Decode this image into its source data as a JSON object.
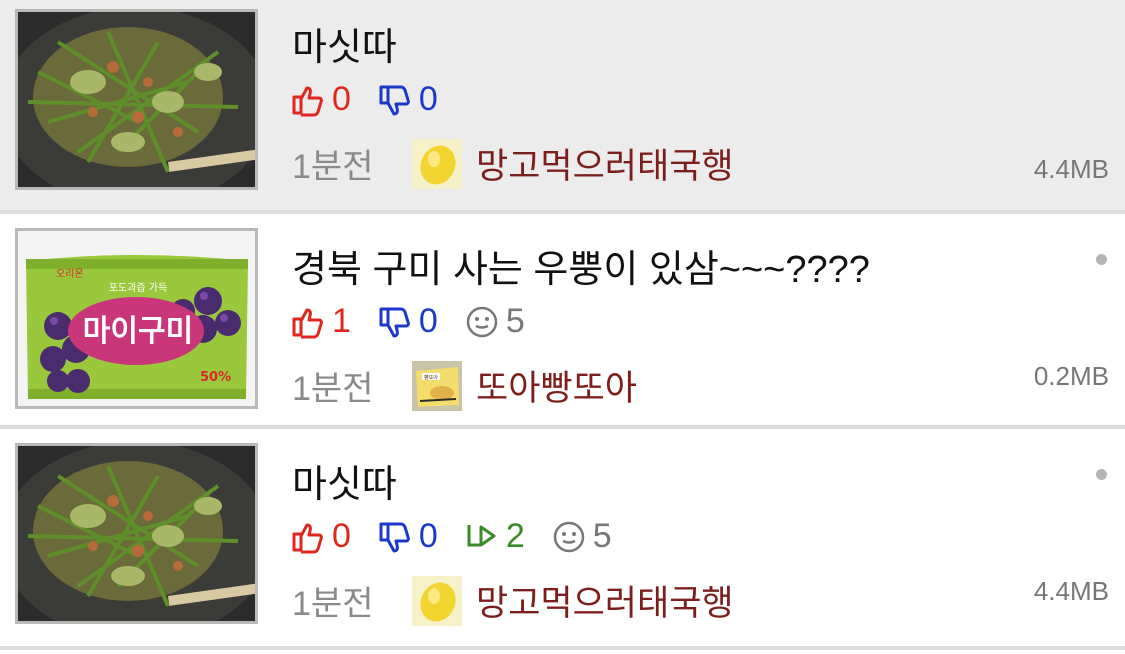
{
  "posts": [
    {
      "title": "마싯따",
      "likes": "0",
      "dislikes": "0",
      "time": "1분전",
      "author": "망고먹으러태국행",
      "size": "4.4MB",
      "thumbnail_icon": "stir-fry-food-photo",
      "avatar_icon": "yellow-mango-avatar"
    },
    {
      "title": "경북 구미 사는 우뿡이 있삼~~~????",
      "likes": "1",
      "dislikes": "0",
      "comments": "5",
      "time": "1분전",
      "author": "또아빵또아",
      "size": "0.2MB",
      "thumbnail_icon": "grape-candy-package-photo",
      "thumbnail_text": {
        "brand": "오리온",
        "product": "마이구미",
        "badge": "50%",
        "tagline": "포도과즙 가득"
      },
      "avatar_icon": "bread-package-avatar",
      "avatar_text": "빵또아"
    },
    {
      "title": "마싯따",
      "likes": "0",
      "dislikes": "0",
      "replies": "2",
      "comments": "5",
      "time": "1분전",
      "author": "망고먹으러태국행",
      "size": "4.4MB",
      "thumbnail_icon": "stir-fry-food-photo",
      "avatar_icon": "yellow-mango-avatar"
    }
  ],
  "colors": {
    "like": "#e0261f",
    "dislike": "#1b38c9",
    "reply": "#3a8a2a",
    "author": "#7d1e1e",
    "selected_row_bg": "#ececec"
  }
}
